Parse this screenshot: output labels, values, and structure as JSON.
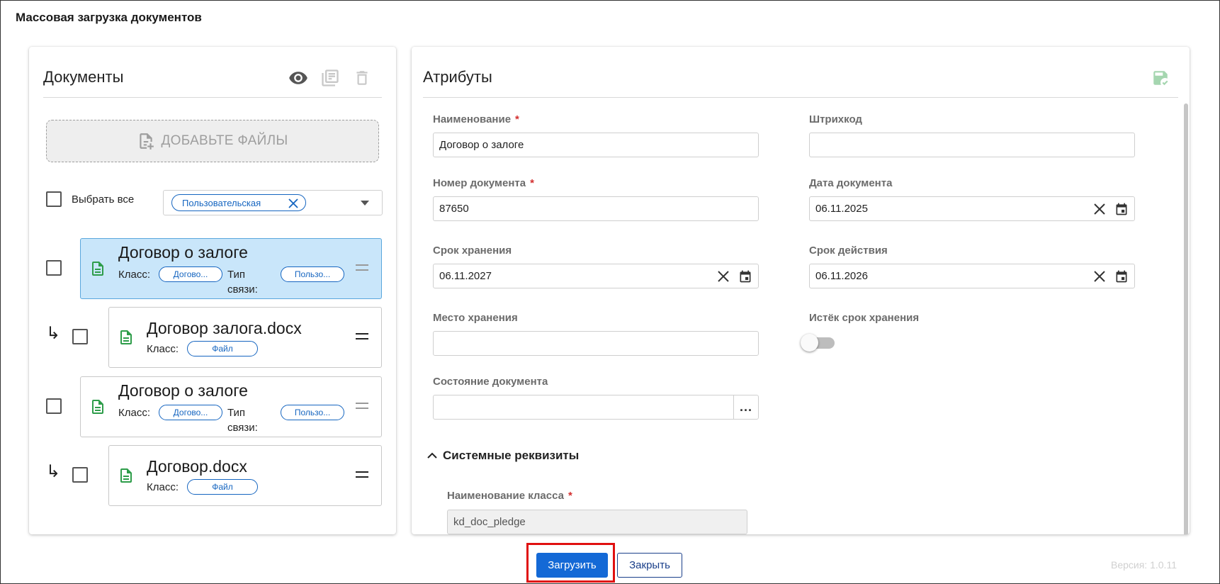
{
  "window": {
    "title": "Массовая загрузка документов"
  },
  "documents": {
    "title": "Документы",
    "toolbar": {
      "view_icon": "eye-icon",
      "copy_icon": "copy-list-icon",
      "delete_icon": "trash-icon"
    },
    "add_files_label": "ДОБАВЬТЕ ФАЙЛЫ",
    "select_all_label": "Выбрать все",
    "filter_chip": "Пользовательская",
    "items": [
      {
        "name": "Договор о залоге",
        "class_label": "Класс:",
        "class_chip": "Догово...",
        "link_label_1": "Тип",
        "link_label_2": "связи:",
        "link_chip": "Пользо...",
        "selected": true
      },
      {
        "name": "Договор залога.docx",
        "class_label": "Класс:",
        "class_chip": "Файл",
        "child": true
      },
      {
        "name": "Договор о залоге",
        "class_label": "Класс:",
        "class_chip": "Догово...",
        "link_label_1": "Тип",
        "link_label_2": "связи:",
        "link_chip": "Пользо...",
        "selected": false
      },
      {
        "name": "Договор.docx",
        "class_label": "Класс:",
        "class_chip": "Файл",
        "child": true
      }
    ],
    "child_arrow": "↳"
  },
  "attributes": {
    "title": "Атрибуты",
    "save_icon": "save-check-icon",
    "fields": {
      "name": {
        "label": "Наименование",
        "required": "*",
        "value": "Договор о залоге"
      },
      "barcode": {
        "label": "Штрихкод",
        "value": ""
      },
      "doc_number": {
        "label": "Номер документа",
        "required": "*",
        "value": "87650"
      },
      "doc_date": {
        "label": "Дата документа",
        "value": "06.11.2025"
      },
      "storage_term": {
        "label": "Срок хранения",
        "value": "06.11.2027"
      },
      "validity_term": {
        "label": "Срок действия",
        "value": "06.11.2026"
      },
      "storage_place": {
        "label": "Место хранения",
        "value": ""
      },
      "storage_expired": {
        "label": "Истёк срок хранения",
        "value": false
      },
      "doc_state": {
        "label": "Состояние документа",
        "value": "",
        "button": "..."
      }
    },
    "system_section": {
      "title": "Системные реквизиты",
      "class_name": {
        "label": "Наименование класса",
        "required": "*",
        "value": "kd_doc_pledge"
      }
    }
  },
  "footer": {
    "upload_label": "Загрузить",
    "close_label": "Закрыть",
    "version": "Версия: 1.0.11"
  },
  "colors": {
    "primary": "#1469d6",
    "selected_row": "#c9e6fa",
    "doc_icon": "#2e9d4a",
    "highlight": "#e01010"
  }
}
